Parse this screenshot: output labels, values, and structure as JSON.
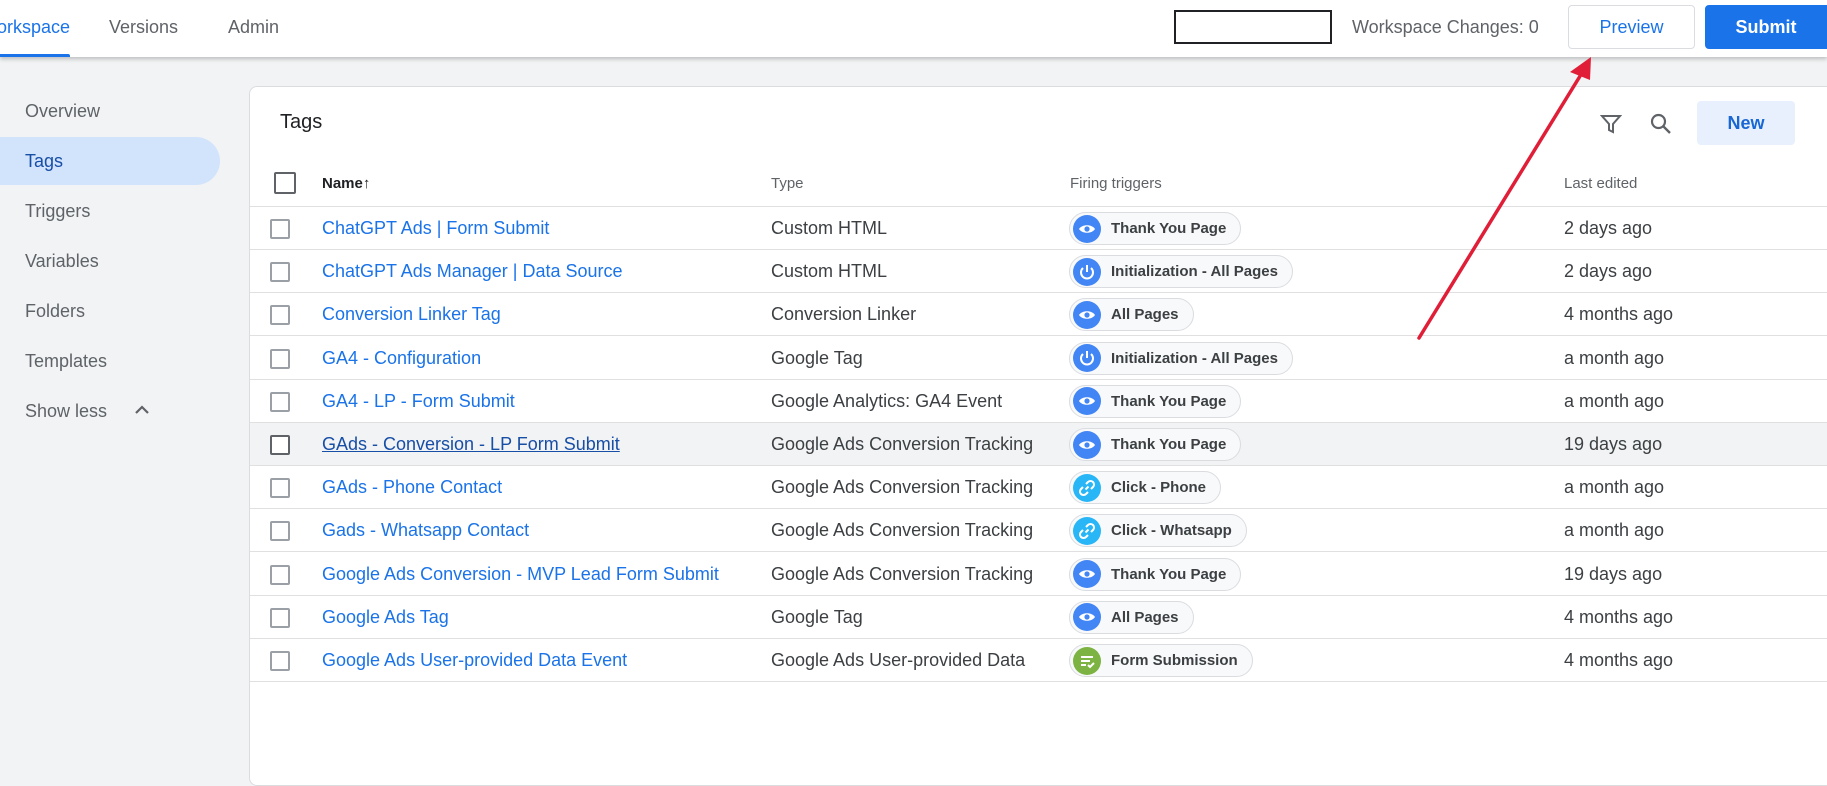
{
  "header": {
    "tabs": [
      {
        "label": "orkspace",
        "active": true
      },
      {
        "label": "Versions",
        "active": false
      },
      {
        "label": "Admin",
        "active": false
      }
    ],
    "workspace_changes_label": "Workspace Changes:",
    "workspace_changes_count": "0",
    "preview_label": "Preview",
    "submit_label": "Submit"
  },
  "sidebar": {
    "items": [
      {
        "label": "Overview",
        "active": false
      },
      {
        "label": "Tags",
        "active": true
      },
      {
        "label": "Triggers",
        "active": false
      },
      {
        "label": "Variables",
        "active": false
      },
      {
        "label": "Folders",
        "active": false
      },
      {
        "label": "Templates",
        "active": false
      }
    ],
    "show_less_label": "Show less"
  },
  "panel": {
    "title": "Tags",
    "new_label": "New",
    "icons": [
      "filter-icon",
      "search-icon"
    ],
    "columns": {
      "name": "Name",
      "type": "Type",
      "triggers": "Firing triggers",
      "edited": "Last edited"
    },
    "sort_indicator": "↑"
  },
  "trigger_styles": {
    "pageview": {
      "icon": "eye-icon",
      "color": "#4285f4"
    },
    "init": {
      "icon": "power-icon",
      "color": "#4285f4"
    },
    "click": {
      "icon": "link-icon",
      "color": "#29b6f6"
    },
    "form": {
      "icon": "form-icon",
      "color": "#7cb342"
    }
  },
  "rows": [
    {
      "name": "ChatGPT Ads | Form Submit",
      "type": "Custom HTML",
      "trigger": "Thank You Page",
      "trigger_kind": "pageview",
      "edited": "2 days ago"
    },
    {
      "name": "ChatGPT Ads Manager | Data Source",
      "type": "Custom HTML",
      "trigger": "Initialization - All Pages",
      "trigger_kind": "init",
      "edited": "2 days ago"
    },
    {
      "name": "Conversion Linker Tag",
      "type": "Conversion Linker",
      "trigger": "All Pages",
      "trigger_kind": "pageview",
      "edited": "4 months ago"
    },
    {
      "name": "GA4 - Configuration",
      "type": "Google Tag",
      "trigger": "Initialization - All Pages",
      "trigger_kind": "init",
      "edited": "a month ago"
    },
    {
      "name": "GA4 - LP - Form Submit",
      "type": "Google Analytics: GA4 Event",
      "trigger": "Thank You Page",
      "trigger_kind": "pageview",
      "edited": "a month ago"
    },
    {
      "name": "GAds - Conversion - LP Form Submit",
      "type": "Google Ads Conversion Tracking",
      "trigger": "Thank You Page",
      "trigger_kind": "pageview",
      "edited": "19 days ago",
      "hover": true
    },
    {
      "name": "GAds - Phone Contact",
      "type": "Google Ads Conversion Tracking",
      "trigger": "Click - Phone",
      "trigger_kind": "click",
      "edited": "a month ago"
    },
    {
      "name": "Gads - Whatsapp Contact",
      "type": "Google Ads Conversion Tracking",
      "trigger": "Click - Whatsapp",
      "trigger_kind": "click",
      "edited": "a month ago"
    },
    {
      "name": "Google Ads Conversion - MVP Lead Form Submit",
      "type": "Google Ads Conversion Tracking",
      "trigger": "Thank You Page",
      "trigger_kind": "pageview",
      "edited": "19 days ago"
    },
    {
      "name": "Google Ads Tag",
      "type": "Google Tag",
      "trigger": "All Pages",
      "trigger_kind": "pageview",
      "edited": "4 months ago"
    },
    {
      "name": "Google Ads User-provided Data Event",
      "type": "Google Ads User-provided Data",
      "trigger": "Form Submission",
      "trigger_kind": "form",
      "edited": "4 months ago"
    }
  ],
  "annotation": {
    "color": "#e01e37"
  }
}
